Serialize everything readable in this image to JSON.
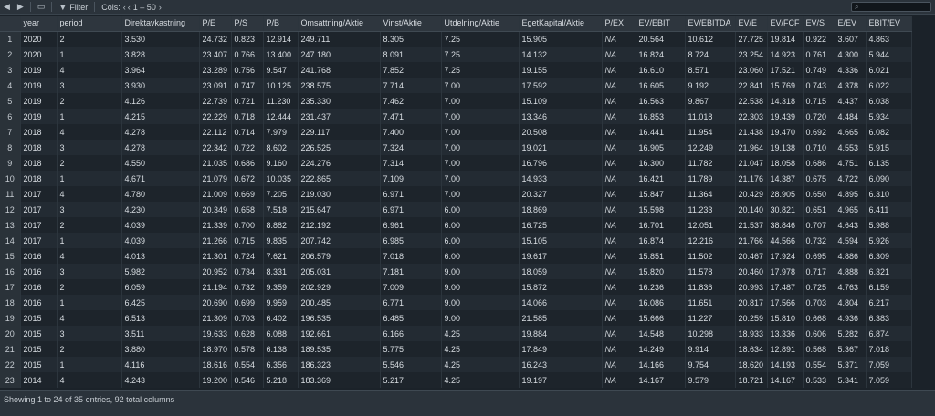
{
  "toolbar": {
    "filter_label": "Filter",
    "cols_label": "Cols:",
    "cols_range": "1 – 50",
    "search_placeholder": ""
  },
  "table": {
    "columns": [
      "",
      "year",
      "period",
      "Direktavkastning",
      "P/E",
      "P/S",
      "P/B",
      "Omsattning/Aktie",
      "Vinst/Aktie",
      "Utdelning/Aktie",
      "EgetKapital/Aktie",
      "P/EX",
      "EV/EBIT",
      "EV/EBITDA",
      "EV/E",
      "EV/FCF",
      "EV/S",
      "E/EV",
      "EBIT/EV"
    ],
    "rows": [
      [
        "1",
        "2020",
        "2",
        "3.530",
        "24.732",
        "0.823",
        "12.914",
        "249.711",
        "8.305",
        "7.25",
        "15.905",
        "NA",
        "20.564",
        "10.612",
        "27.725",
        "19.814",
        "0.922",
        "3.607",
        "4.863"
      ],
      [
        "2",
        "2020",
        "1",
        "3.828",
        "23.407",
        "0.766",
        "13.400",
        "247.180",
        "8.091",
        "7.25",
        "14.132",
        "NA",
        "16.824",
        "8.724",
        "23.254",
        "14.923",
        "0.761",
        "4.300",
        "5.944"
      ],
      [
        "3",
        "2019",
        "4",
        "3.964",
        "23.289",
        "0.756",
        "9.547",
        "241.768",
        "7.852",
        "7.25",
        "19.155",
        "NA",
        "16.610",
        "8.571",
        "23.060",
        "17.521",
        "0.749",
        "4.336",
        "6.021"
      ],
      [
        "4",
        "2019",
        "3",
        "3.930",
        "23.091",
        "0.747",
        "10.125",
        "238.575",
        "7.714",
        "7.00",
        "17.592",
        "NA",
        "16.605",
        "9.192",
        "22.841",
        "15.769",
        "0.743",
        "4.378",
        "6.022"
      ],
      [
        "5",
        "2019",
        "2",
        "4.126",
        "22.739",
        "0.721",
        "11.230",
        "235.330",
        "7.462",
        "7.00",
        "15.109",
        "NA",
        "16.563",
        "9.867",
        "22.538",
        "14.318",
        "0.715",
        "4.437",
        "6.038"
      ],
      [
        "6",
        "2019",
        "1",
        "4.215",
        "22.229",
        "0.718",
        "12.444",
        "231.437",
        "7.471",
        "7.00",
        "13.346",
        "NA",
        "16.853",
        "11.018",
        "22.303",
        "19.439",
        "0.720",
        "4.484",
        "5.934"
      ],
      [
        "7",
        "2018",
        "4",
        "4.278",
        "22.112",
        "0.714",
        "7.979",
        "229.117",
        "7.400",
        "7.00",
        "20.508",
        "NA",
        "16.441",
        "11.954",
        "21.438",
        "19.470",
        "0.692",
        "4.665",
        "6.082"
      ],
      [
        "8",
        "2018",
        "3",
        "4.278",
        "22.342",
        "0.722",
        "8.602",
        "226.525",
        "7.324",
        "7.00",
        "19.021",
        "NA",
        "16.905",
        "12.249",
        "21.964",
        "19.138",
        "0.710",
        "4.553",
        "5.915"
      ],
      [
        "9",
        "2018",
        "2",
        "4.550",
        "21.035",
        "0.686",
        "9.160",
        "224.276",
        "7.314",
        "7.00",
        "16.796",
        "NA",
        "16.300",
        "11.782",
        "21.047",
        "18.058",
        "0.686",
        "4.751",
        "6.135"
      ],
      [
        "10",
        "2018",
        "1",
        "4.671",
        "21.079",
        "0.672",
        "10.035",
        "222.865",
        "7.109",
        "7.00",
        "14.933",
        "NA",
        "16.421",
        "11.789",
        "21.176",
        "14.387",
        "0.675",
        "4.722",
        "6.090"
      ],
      [
        "11",
        "2017",
        "4",
        "4.780",
        "21.009",
        "0.669",
        "7.205",
        "219.030",
        "6.971",
        "7.00",
        "20.327",
        "NA",
        "15.847",
        "11.364",
        "20.429",
        "28.905",
        "0.650",
        "4.895",
        "6.310"
      ],
      [
        "12",
        "2017",
        "3",
        "4.230",
        "20.349",
        "0.658",
        "7.518",
        "215.647",
        "6.971",
        "6.00",
        "18.869",
        "NA",
        "15.598",
        "11.233",
        "20.140",
        "30.821",
        "0.651",
        "4.965",
        "6.411"
      ],
      [
        "13",
        "2017",
        "2",
        "4.039",
        "21.339",
        "0.700",
        "8.882",
        "212.192",
        "6.961",
        "6.00",
        "16.725",
        "NA",
        "16.701",
        "12.051",
        "21.537",
        "38.846",
        "0.707",
        "4.643",
        "5.988"
      ],
      [
        "14",
        "2017",
        "1",
        "4.039",
        "21.266",
        "0.715",
        "9.835",
        "207.742",
        "6.985",
        "6.00",
        "15.105",
        "NA",
        "16.874",
        "12.216",
        "21.766",
        "44.566",
        "0.732",
        "4.594",
        "5.926"
      ],
      [
        "15",
        "2016",
        "4",
        "4.013",
        "21.301",
        "0.724",
        "7.621",
        "206.579",
        "7.018",
        "6.00",
        "19.617",
        "NA",
        "15.851",
        "11.502",
        "20.467",
        "17.924",
        "0.695",
        "4.886",
        "6.309"
      ],
      [
        "16",
        "2016",
        "3",
        "5.982",
        "20.952",
        "0.734",
        "8.331",
        "205.031",
        "7.181",
        "9.00",
        "18.059",
        "NA",
        "15.820",
        "11.578",
        "20.460",
        "17.978",
        "0.717",
        "4.888",
        "6.321"
      ],
      [
        "17",
        "2016",
        "2",
        "6.059",
        "21.194",
        "0.732",
        "9.359",
        "202.929",
        "7.009",
        "9.00",
        "15.872",
        "NA",
        "16.236",
        "11.836",
        "20.993",
        "17.487",
        "0.725",
        "4.763",
        "6.159"
      ],
      [
        "18",
        "2016",
        "1",
        "6.425",
        "20.690",
        "0.699",
        "9.959",
        "200.485",
        "6.771",
        "9.00",
        "14.066",
        "NA",
        "16.086",
        "11.651",
        "20.817",
        "17.566",
        "0.703",
        "4.804",
        "6.217"
      ],
      [
        "19",
        "2015",
        "4",
        "6.513",
        "21.309",
        "0.703",
        "6.402",
        "196.535",
        "6.485",
        "9.00",
        "21.585",
        "NA",
        "15.666",
        "11.227",
        "20.259",
        "15.810",
        "0.668",
        "4.936",
        "6.383"
      ],
      [
        "20",
        "2015",
        "3",
        "3.511",
        "19.633",
        "0.628",
        "6.088",
        "192.661",
        "6.166",
        "4.25",
        "19.884",
        "NA",
        "14.548",
        "10.298",
        "18.933",
        "13.336",
        "0.606",
        "5.282",
        "6.874"
      ],
      [
        "21",
        "2015",
        "2",
        "3.880",
        "18.970",
        "0.578",
        "6.138",
        "189.535",
        "5.775",
        "4.25",
        "17.849",
        "NA",
        "14.249",
        "9.914",
        "18.634",
        "12.891",
        "0.568",
        "5.367",
        "7.018"
      ],
      [
        "22",
        "2015",
        "1",
        "4.116",
        "18.616",
        "0.554",
        "6.356",
        "186.323",
        "5.546",
        "4.25",
        "16.243",
        "NA",
        "14.166",
        "9.754",
        "18.620",
        "14.193",
        "0.554",
        "5.371",
        "7.059"
      ],
      [
        "23",
        "2014",
        "4",
        "4.243",
        "19.200",
        "0.546",
        "5.218",
        "183.369",
        "5.217",
        "4.25",
        "19.197",
        "NA",
        "14.167",
        "9.579",
        "18.721",
        "14.167",
        "0.533",
        "5.341",
        "7.059"
      ]
    ]
  },
  "status": {
    "text": "Showing 1 to 24 of 35 entries, 92 total columns"
  }
}
